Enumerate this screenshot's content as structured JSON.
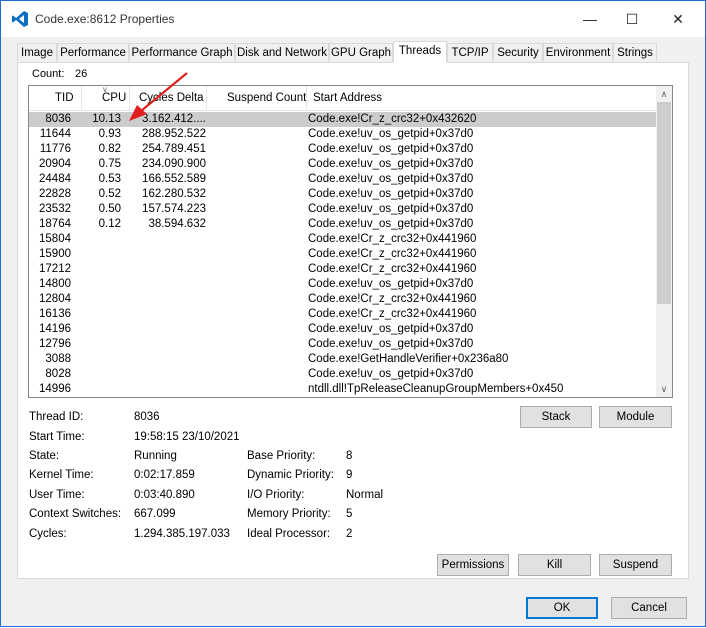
{
  "window": {
    "title": "Code.exe:8612 Properties"
  },
  "tabs": [
    "Image",
    "Performance",
    "Performance Graph",
    "Disk and Network",
    "GPU Graph",
    "Threads",
    "TCP/IP",
    "Security",
    "Environment",
    "Strings"
  ],
  "active_tab": "Threads",
  "count": {
    "label": "Count:",
    "value": "26"
  },
  "columns": [
    "TID",
    "CPU",
    "Cycles Delta",
    "Suspend Count",
    "Start Address"
  ],
  "rows": [
    {
      "tid": "8036",
      "cpu": "10.13",
      "cycles": "3.162.412....",
      "addr": "Code.exe!Cr_z_crc32+0x432620"
    },
    {
      "tid": "11644",
      "cpu": "0.93",
      "cycles": "288.952.522",
      "addr": "Code.exe!uv_os_getpid+0x37d0"
    },
    {
      "tid": "11776",
      "cpu": "0.82",
      "cycles": "254.789.451",
      "addr": "Code.exe!uv_os_getpid+0x37d0"
    },
    {
      "tid": "20904",
      "cpu": "0.75",
      "cycles": "234.090.900",
      "addr": "Code.exe!uv_os_getpid+0x37d0"
    },
    {
      "tid": "24484",
      "cpu": "0.53",
      "cycles": "166.552.589",
      "addr": "Code.exe!uv_os_getpid+0x37d0"
    },
    {
      "tid": "22828",
      "cpu": "0.52",
      "cycles": "162.280.532",
      "addr": "Code.exe!uv_os_getpid+0x37d0"
    },
    {
      "tid": "23532",
      "cpu": "0.50",
      "cycles": "157.574.223",
      "addr": "Code.exe!uv_os_getpid+0x37d0"
    },
    {
      "tid": "18764",
      "cpu": "0.12",
      "cycles": "38.594.632",
      "addr": "Code.exe!uv_os_getpid+0x37d0"
    },
    {
      "tid": "15804",
      "cpu": "",
      "cycles": "",
      "addr": "Code.exe!Cr_z_crc32+0x441960"
    },
    {
      "tid": "15900",
      "cpu": "",
      "cycles": "",
      "addr": "Code.exe!Cr_z_crc32+0x441960"
    },
    {
      "tid": "17212",
      "cpu": "",
      "cycles": "",
      "addr": "Code.exe!Cr_z_crc32+0x441960"
    },
    {
      "tid": "14800",
      "cpu": "",
      "cycles": "",
      "addr": "Code.exe!uv_os_getpid+0x37d0"
    },
    {
      "tid": "12804",
      "cpu": "",
      "cycles": "",
      "addr": "Code.exe!Cr_z_crc32+0x441960"
    },
    {
      "tid": "16136",
      "cpu": "",
      "cycles": "",
      "addr": "Code.exe!Cr_z_crc32+0x441960"
    },
    {
      "tid": "14196",
      "cpu": "",
      "cycles": "",
      "addr": "Code.exe!uv_os_getpid+0x37d0"
    },
    {
      "tid": "12796",
      "cpu": "",
      "cycles": "",
      "addr": "Code.exe!uv_os_getpid+0x37d0"
    },
    {
      "tid": "3088",
      "cpu": "",
      "cycles": "",
      "addr": "Code.exe!GetHandleVerifier+0x236a80"
    },
    {
      "tid": "8028",
      "cpu": "",
      "cycles": "",
      "addr": "Code.exe!uv_os_getpid+0x37d0"
    },
    {
      "tid": "14996",
      "cpu": "",
      "cycles": "",
      "addr": "ntdll.dll!TpReleaseCleanupGroupMembers+0x450"
    }
  ],
  "buttons": {
    "stack": "Stack",
    "module": "Module",
    "permissions": "Permissions",
    "kill": "Kill",
    "suspend": "Suspend",
    "ok": "OK",
    "cancel": "Cancel"
  },
  "details_left": [
    {
      "label": "Thread ID:",
      "value": "8036"
    },
    {
      "label": "Start Time:",
      "value": "19:58:15  23/10/2021"
    },
    {
      "label": "State:",
      "value": "Running"
    },
    {
      "label": "Kernel Time:",
      "value": "0:02:17.859"
    },
    {
      "label": "User Time:",
      "value": "0:03:40.890"
    },
    {
      "label": "Context Switches:",
      "value": "667.099"
    },
    {
      "label": "Cycles:",
      "value": "1.294.385.197.033"
    }
  ],
  "details_right": [
    {
      "label": "Base Priority:",
      "value": "8"
    },
    {
      "label": "Dynamic Priority:",
      "value": "9"
    },
    {
      "label": "I/O Priority:",
      "value": "Normal"
    },
    {
      "label": "Memory Priority:",
      "value": "5"
    },
    {
      "label": "Ideal Processor:",
      "value": "2"
    }
  ],
  "colors": {
    "accent": "#0078d4",
    "selected_row": "#cccccc",
    "annotation_arrow": "#e02020"
  },
  "icons": {
    "app": "vscode-icon",
    "minimize": "minimize-icon",
    "maximize": "maximize-icon",
    "close": "close-icon",
    "annotation": "red-arrow-icon"
  }
}
